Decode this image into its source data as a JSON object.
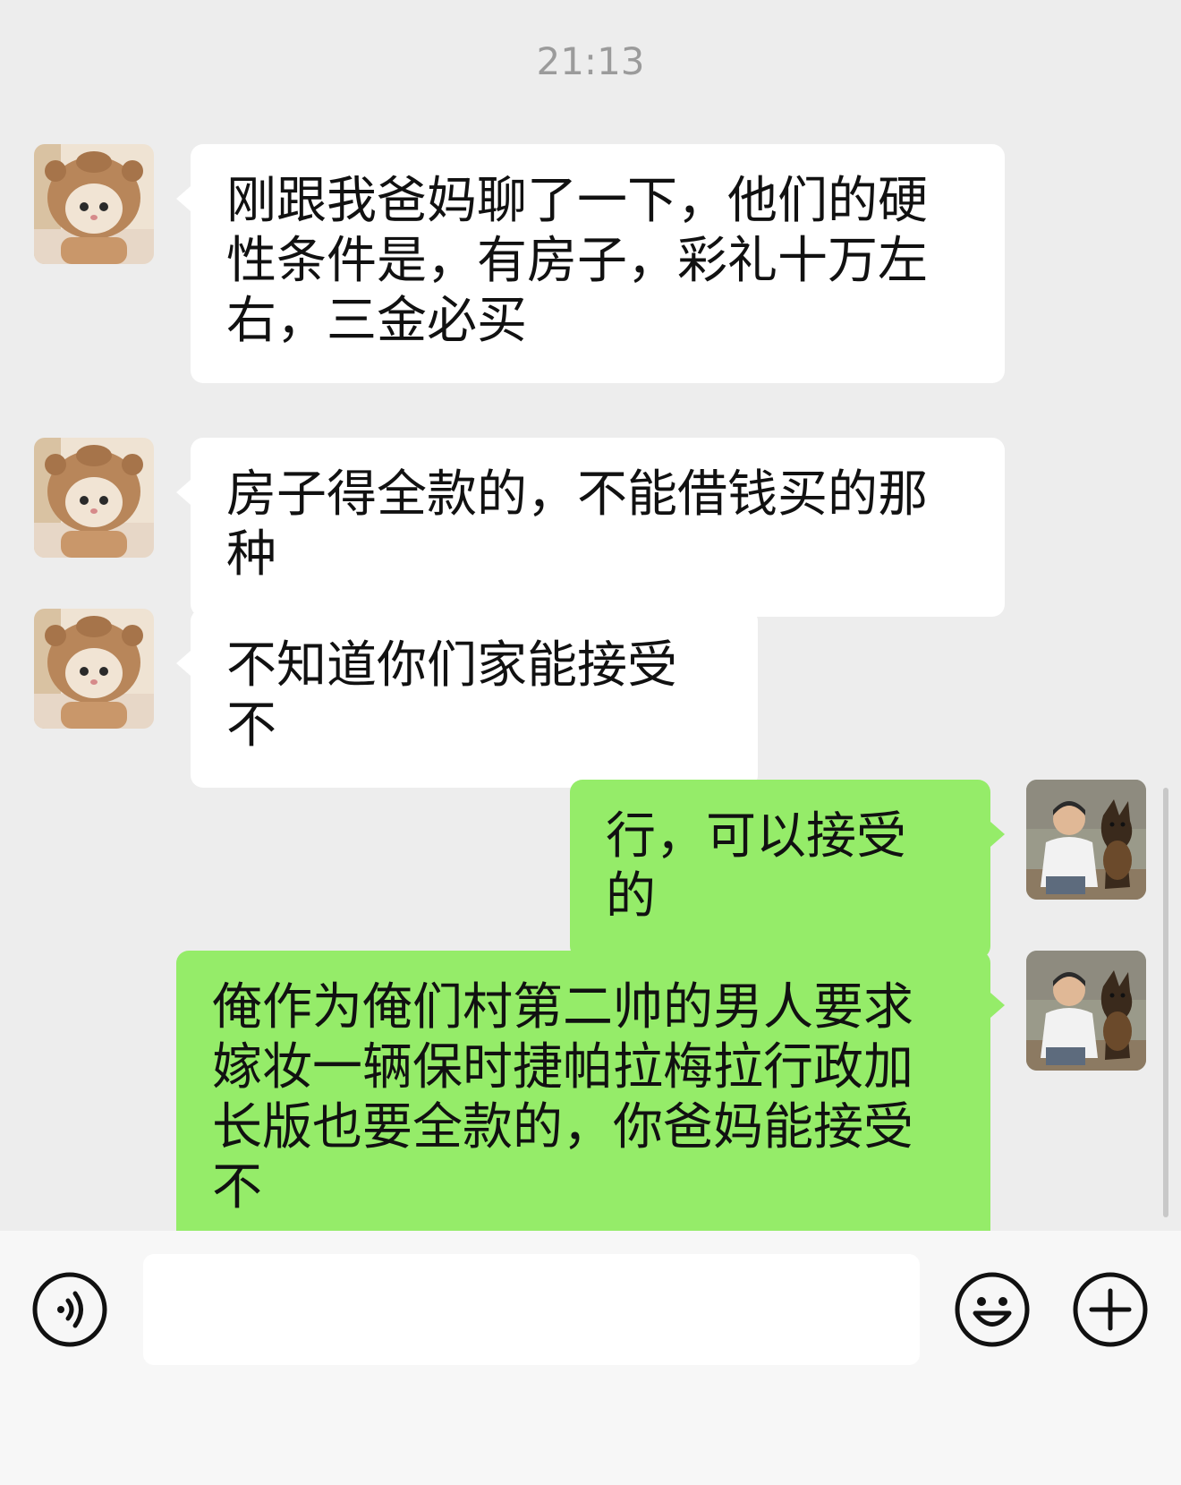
{
  "chat": {
    "timestamp": "21:13",
    "messages": [
      {
        "sender": "other",
        "text": "刚跟我爸妈聊了一下，他们的硬性条件是，有房子，彩礼十万左右，三金必买"
      },
      {
        "sender": "other",
        "text": "房子得全款的，不能借钱买的那种"
      },
      {
        "sender": "other",
        "text": "不知道你们家能接受不"
      },
      {
        "sender": "self",
        "text": "行，可以接受的"
      },
      {
        "sender": "self",
        "text": "俺作为俺们村第二帅的男人要求嫁妆一辆保时捷帕拉梅拉行政加长版也要全款的，你爸妈能接受不"
      }
    ]
  },
  "avatars": {
    "other": "cat-in-bear-hood-avatar",
    "self": "man-with-dog-avatar"
  },
  "input_bar": {
    "voice_icon": "voice-icon",
    "text_value": "",
    "emoji_icon": "emoji-icon",
    "plus_icon": "plus-icon"
  },
  "colors": {
    "background": "#ededed",
    "incoming_bubble": "#ffffff",
    "outgoing_bubble": "#95ec69",
    "timestamp_text": "#9b9b9b"
  }
}
